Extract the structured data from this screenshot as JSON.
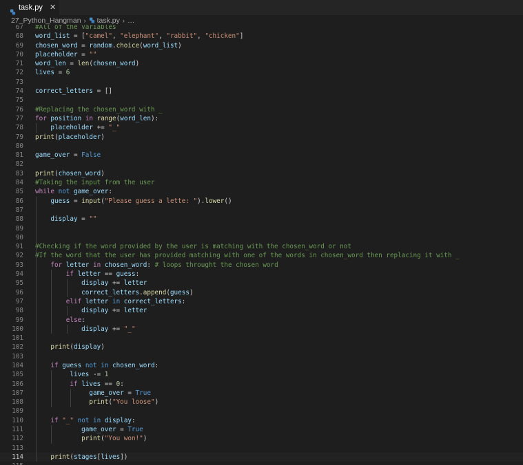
{
  "tab": {
    "filename": "task.py",
    "close": "✕",
    "icon": "python-file-icon"
  },
  "breadcrumb": {
    "folder": "27_Python_Hangman",
    "file": "task.py",
    "tail": "…",
    "sep": "›"
  },
  "colors": {
    "keyword": "#c586c0",
    "keyword_blue": "#569cd6",
    "function": "#dcdcaa",
    "string": "#ce9178",
    "number": "#b5cea8",
    "variable": "#9cdcfe",
    "comment": "#6a9955",
    "constant": "#4fc1ff",
    "text": "#d4d4d4",
    "line_number": "#858585",
    "background": "#1e1e1e"
  },
  "current_line": 114,
  "lines": [
    {
      "n": "67",
      "tokens": [
        [
          "cm",
          "#All of the variables"
        ]
      ]
    },
    {
      "n": "68",
      "tokens": [
        [
          "var",
          "word_list"
        ],
        [
          "tx",
          " = ["
        ],
        [
          "str",
          "\"camel\""
        ],
        [
          "tx",
          ", "
        ],
        [
          "str",
          "\"elephant\""
        ],
        [
          "tx",
          ", "
        ],
        [
          "str",
          "\"rabbit\""
        ],
        [
          "tx",
          ", "
        ],
        [
          "str",
          "\"chicken\""
        ],
        [
          "tx",
          "]"
        ]
      ]
    },
    {
      "n": "69",
      "tokens": [
        [
          "var",
          "chosen_word"
        ],
        [
          "tx",
          " = "
        ],
        [
          "var",
          "random"
        ],
        [
          "tx",
          "."
        ],
        [
          "fn",
          "choice"
        ],
        [
          "tx",
          "("
        ],
        [
          "var",
          "word_list"
        ],
        [
          "tx",
          ")"
        ]
      ]
    },
    {
      "n": "70",
      "tokens": [
        [
          "var",
          "placeholder"
        ],
        [
          "tx",
          " = "
        ],
        [
          "str",
          "\"\""
        ]
      ]
    },
    {
      "n": "71",
      "tokens": [
        [
          "var",
          "word_len"
        ],
        [
          "tx",
          " = "
        ],
        [
          "fn",
          "len"
        ],
        [
          "tx",
          "("
        ],
        [
          "var",
          "chosen_word"
        ],
        [
          "tx",
          ")"
        ]
      ]
    },
    {
      "n": "72",
      "tokens": [
        [
          "var",
          "lives"
        ],
        [
          "tx",
          " = "
        ],
        [
          "num",
          "6"
        ]
      ]
    },
    {
      "n": "73",
      "tokens": []
    },
    {
      "n": "74",
      "tokens": [
        [
          "var",
          "correct_letters"
        ],
        [
          "tx",
          " = []"
        ]
      ]
    },
    {
      "n": "75",
      "tokens": []
    },
    {
      "n": "76",
      "tokens": [
        [
          "cm",
          "#Replacing the chosen_word with _"
        ]
      ]
    },
    {
      "n": "77",
      "tokens": [
        [
          "kw",
          "for"
        ],
        [
          "tx",
          " "
        ],
        [
          "var",
          "position"
        ],
        [
          "tx",
          " "
        ],
        [
          "kw",
          "in"
        ],
        [
          "tx",
          " "
        ],
        [
          "fn",
          "range"
        ],
        [
          "tx",
          "("
        ],
        [
          "var",
          "word_len"
        ],
        [
          "tx",
          "):"
        ]
      ]
    },
    {
      "n": "78",
      "tokens": [
        [
          "tx",
          "    "
        ],
        [
          "var",
          "placeholder"
        ],
        [
          "tx",
          " += "
        ],
        [
          "str",
          "\"_\""
        ]
      ]
    },
    {
      "n": "79",
      "tokens": [
        [
          "fn",
          "print"
        ],
        [
          "tx",
          "("
        ],
        [
          "var",
          "placeholder"
        ],
        [
          "tx",
          ")"
        ]
      ]
    },
    {
      "n": "80",
      "tokens": []
    },
    {
      "n": "81",
      "tokens": [
        [
          "var",
          "game_over"
        ],
        [
          "tx",
          " = "
        ],
        [
          "kw2",
          "False"
        ]
      ]
    },
    {
      "n": "82",
      "tokens": []
    },
    {
      "n": "83",
      "tokens": [
        [
          "fn",
          "print"
        ],
        [
          "tx",
          "("
        ],
        [
          "var",
          "chosen_word"
        ],
        [
          "tx",
          ")"
        ]
      ]
    },
    {
      "n": "84",
      "tokens": [
        [
          "cm",
          "#Taking the input from the user"
        ]
      ]
    },
    {
      "n": "85",
      "tokens": [
        [
          "kw",
          "while"
        ],
        [
          "tx",
          " "
        ],
        [
          "kw2",
          "not"
        ],
        [
          "tx",
          " "
        ],
        [
          "var",
          "game_over"
        ],
        [
          "tx",
          ":"
        ]
      ]
    },
    {
      "n": "86",
      "tokens": [
        [
          "tx",
          "    "
        ],
        [
          "var",
          "guess"
        ],
        [
          "tx",
          " = "
        ],
        [
          "fn",
          "input"
        ],
        [
          "tx",
          "("
        ],
        [
          "str",
          "\"Please guess a lette: \""
        ],
        [
          "tx",
          ")."
        ],
        [
          "fn",
          "lower"
        ],
        [
          "tx",
          "()"
        ]
      ]
    },
    {
      "n": "87",
      "tokens": []
    },
    {
      "n": "88",
      "tokens": [
        [
          "tx",
          "    "
        ],
        [
          "var",
          "display"
        ],
        [
          "tx",
          " = "
        ],
        [
          "str",
          "\"\""
        ]
      ]
    },
    {
      "n": "89",
      "tokens": []
    },
    {
      "n": "90",
      "tokens": []
    },
    {
      "n": "91",
      "tokens": [
        [
          "cm",
          "#Checking if the word provided by the user is matching with the chosen_word or not"
        ]
      ]
    },
    {
      "n": "92",
      "tokens": [
        [
          "cm",
          "#If the word that the user has provided matching with one of the words in chosen_word then replacing it with _"
        ]
      ]
    },
    {
      "n": "93",
      "tokens": [
        [
          "tx",
          "    "
        ],
        [
          "kw",
          "for"
        ],
        [
          "tx",
          " "
        ],
        [
          "var",
          "letter"
        ],
        [
          "tx",
          " "
        ],
        [
          "kw",
          "in"
        ],
        [
          "tx",
          " "
        ],
        [
          "var",
          "chosen_word"
        ],
        [
          "tx",
          ": "
        ],
        [
          "cm",
          "# loops throught the chosen word"
        ]
      ]
    },
    {
      "n": "94",
      "tokens": [
        [
          "tx",
          "        "
        ],
        [
          "kw",
          "if"
        ],
        [
          "tx",
          " "
        ],
        [
          "var",
          "letter"
        ],
        [
          "tx",
          " == "
        ],
        [
          "var",
          "guess"
        ],
        [
          "tx",
          ":"
        ]
      ]
    },
    {
      "n": "95",
      "tokens": [
        [
          "tx",
          "            "
        ],
        [
          "var",
          "display"
        ],
        [
          "tx",
          " += "
        ],
        [
          "var",
          "letter"
        ]
      ]
    },
    {
      "n": "96",
      "tokens": [
        [
          "tx",
          "            "
        ],
        [
          "var",
          "correct_letters"
        ],
        [
          "tx",
          "."
        ],
        [
          "fn",
          "append"
        ],
        [
          "tx",
          "("
        ],
        [
          "var",
          "guess"
        ],
        [
          "tx",
          ")"
        ]
      ]
    },
    {
      "n": "97",
      "tokens": [
        [
          "tx",
          "        "
        ],
        [
          "kw",
          "elif"
        ],
        [
          "tx",
          " "
        ],
        [
          "var",
          "letter"
        ],
        [
          "tx",
          " "
        ],
        [
          "kw2",
          "in"
        ],
        [
          "tx",
          " "
        ],
        [
          "var",
          "correct_letters"
        ],
        [
          "tx",
          ":"
        ]
      ]
    },
    {
      "n": "98",
      "tokens": [
        [
          "tx",
          "            "
        ],
        [
          "var",
          "display"
        ],
        [
          "tx",
          " += "
        ],
        [
          "var",
          "letter"
        ]
      ]
    },
    {
      "n": "99",
      "tokens": [
        [
          "tx",
          "        "
        ],
        [
          "kw",
          "else"
        ],
        [
          "tx",
          ":"
        ]
      ]
    },
    {
      "n": "100",
      "tokens": [
        [
          "tx",
          "            "
        ],
        [
          "var",
          "display"
        ],
        [
          "tx",
          " += "
        ],
        [
          "str",
          "\"_\""
        ]
      ]
    },
    {
      "n": "101",
      "tokens": []
    },
    {
      "n": "102",
      "tokens": [
        [
          "tx",
          "    "
        ],
        [
          "fn",
          "print"
        ],
        [
          "tx",
          "("
        ],
        [
          "var",
          "display"
        ],
        [
          "tx",
          ")"
        ]
      ]
    },
    {
      "n": "103",
      "tokens": []
    },
    {
      "n": "104",
      "tokens": [
        [
          "tx",
          "    "
        ],
        [
          "kw",
          "if"
        ],
        [
          "tx",
          " "
        ],
        [
          "var",
          "guess"
        ],
        [
          "tx",
          " "
        ],
        [
          "kw2",
          "not"
        ],
        [
          "tx",
          " "
        ],
        [
          "kw2",
          "in"
        ],
        [
          "tx",
          " "
        ],
        [
          "var",
          "chosen_word"
        ],
        [
          "tx",
          ":"
        ]
      ]
    },
    {
      "n": "105",
      "tokens": [
        [
          "tx",
          "         "
        ],
        [
          "var",
          "lives"
        ],
        [
          "tx",
          " -= "
        ],
        [
          "num",
          "1"
        ]
      ]
    },
    {
      "n": "106",
      "tokens": [
        [
          "tx",
          "         "
        ],
        [
          "kw",
          "if"
        ],
        [
          "tx",
          " "
        ],
        [
          "var",
          "lives"
        ],
        [
          "tx",
          " == "
        ],
        [
          "num",
          "0"
        ],
        [
          "tx",
          ":"
        ]
      ]
    },
    {
      "n": "107",
      "tokens": [
        [
          "tx",
          "              "
        ],
        [
          "var",
          "game_over"
        ],
        [
          "tx",
          " = "
        ],
        [
          "kw2",
          "True"
        ]
      ]
    },
    {
      "n": "108",
      "tokens": [
        [
          "tx",
          "              "
        ],
        [
          "fn",
          "print"
        ],
        [
          "tx",
          "("
        ],
        [
          "str",
          "\"You loose\""
        ],
        [
          "tx",
          ")"
        ]
      ]
    },
    {
      "n": "109",
      "tokens": []
    },
    {
      "n": "110",
      "tokens": [
        [
          "tx",
          "    "
        ],
        [
          "kw",
          "if"
        ],
        [
          "tx",
          " "
        ],
        [
          "str",
          "\"_\""
        ],
        [
          "tx",
          " "
        ],
        [
          "kw2",
          "not"
        ],
        [
          "tx",
          " "
        ],
        [
          "kw2",
          "in"
        ],
        [
          "tx",
          " "
        ],
        [
          "var",
          "display"
        ],
        [
          "tx",
          ":"
        ]
      ]
    },
    {
      "n": "111",
      "tokens": [
        [
          "tx",
          "            "
        ],
        [
          "var",
          "game_over"
        ],
        [
          "tx",
          " = "
        ],
        [
          "kw2",
          "True"
        ]
      ]
    },
    {
      "n": "112",
      "tokens": [
        [
          "tx",
          "            "
        ],
        [
          "fn",
          "print"
        ],
        [
          "tx",
          "("
        ],
        [
          "str",
          "\"You won!\""
        ],
        [
          "tx",
          ")"
        ]
      ]
    },
    {
      "n": "113",
      "tokens": []
    },
    {
      "n": "114",
      "tokens": [
        [
          "tx",
          "    "
        ],
        [
          "fn",
          "print"
        ],
        [
          "tx",
          "("
        ],
        [
          "var",
          "stages"
        ],
        [
          "tx",
          "["
        ],
        [
          "var",
          "lives"
        ],
        [
          "tx",
          "])"
        ]
      ]
    },
    {
      "n": "115",
      "tokens": []
    }
  ]
}
